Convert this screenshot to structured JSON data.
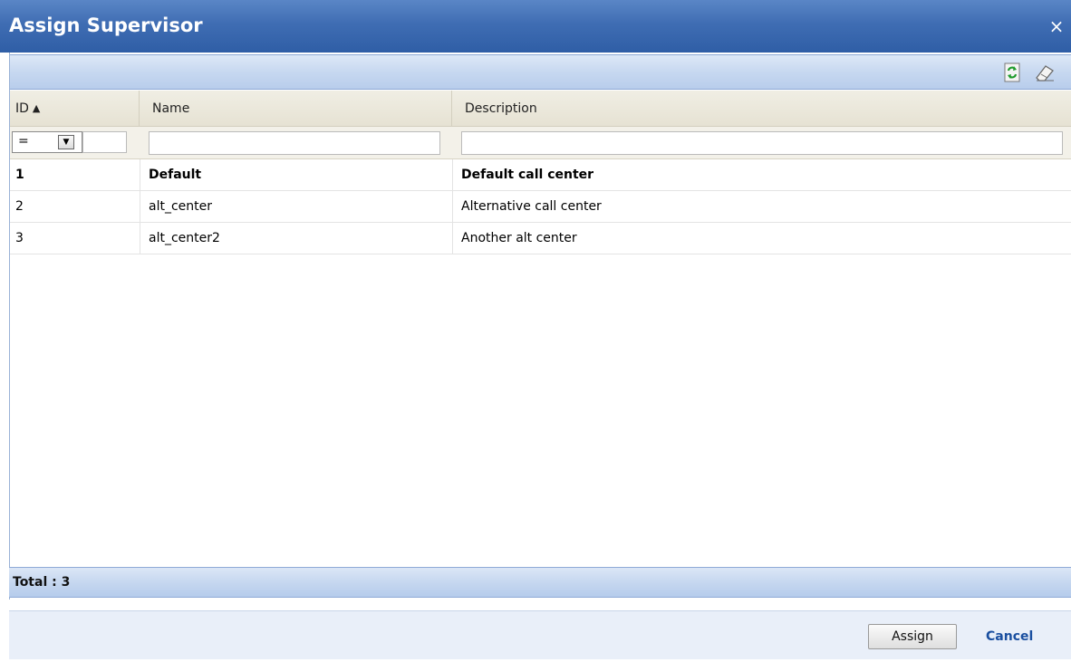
{
  "dialog": {
    "title": "Assign Supervisor",
    "close_glyph": "×"
  },
  "toolbar": {
    "icons": [
      "refresh-icon",
      "eraser-icon"
    ]
  },
  "table": {
    "columns": [
      {
        "label": "ID",
        "sort": "ascending"
      },
      {
        "label": "Name"
      },
      {
        "label": "Description"
      }
    ],
    "filters": {
      "id_operator": "=",
      "id_value": "",
      "name_value": "",
      "description_value": ""
    },
    "rows": [
      {
        "id": "1",
        "name": "Default",
        "description": "Default call center",
        "bold": true
      },
      {
        "id": "2",
        "name": "alt_center",
        "description": "Alternative call center",
        "bold": false
      },
      {
        "id": "3",
        "name": "alt_center2",
        "description": "Another alt center",
        "bold": false
      }
    ]
  },
  "footer": {
    "total_text": "Total : 3"
  },
  "buttons": {
    "assign_label": "Assign",
    "cancel_label": "Cancel"
  },
  "colors": {
    "title_bar": "#3f6db3",
    "toolbar": "#c7d8f0",
    "header": "#e6e2d3",
    "link": "#1a4fa0"
  }
}
